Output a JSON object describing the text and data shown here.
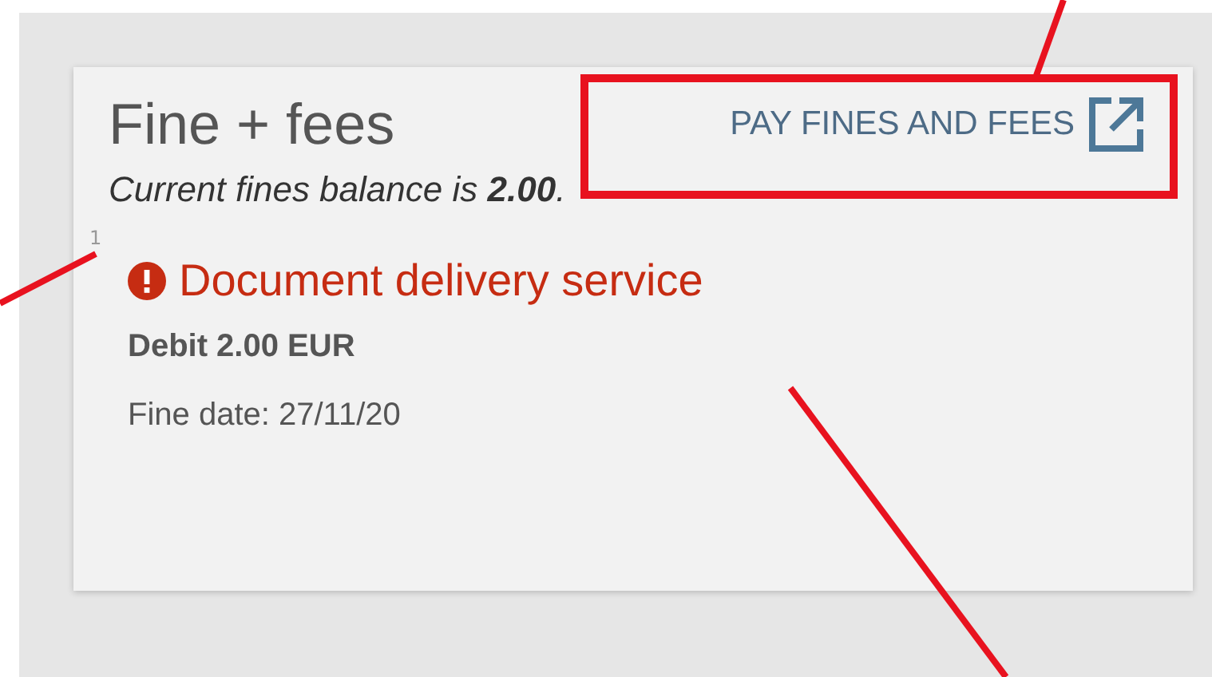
{
  "card": {
    "title": "Fine + fees",
    "pay_button": {
      "label": "PAY FINES AND FEES"
    },
    "balance_text": "Current fines balance is **2.00**.",
    "fines": [
      {
        "index": "1",
        "error": true,
        "title": "Document delivery service",
        "debit": "Debit 2.00 EUR",
        "date": "Fine date: 27/11/20"
      }
    ]
  }
}
